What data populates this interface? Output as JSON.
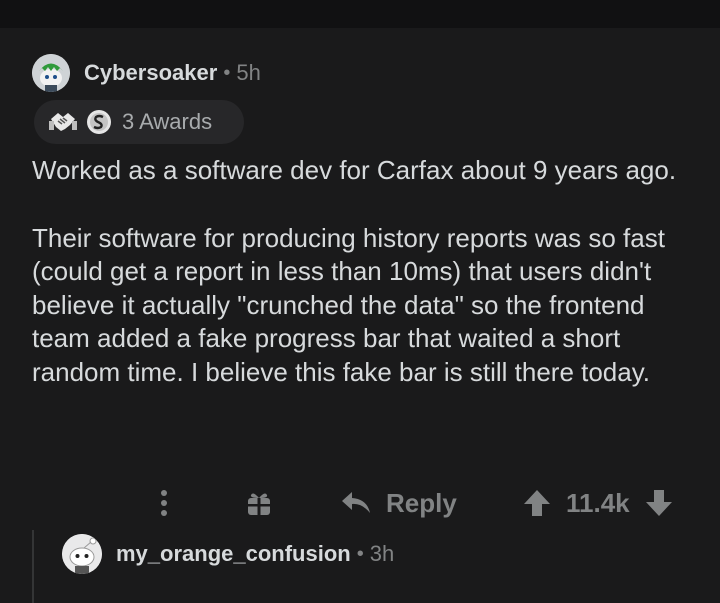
{
  "comment": {
    "username": "Cybersoaker",
    "separator": "•",
    "time": "5h",
    "awards_label": "3 Awards",
    "award_icons": [
      "handshake-icon",
      "silver-coin-icon"
    ],
    "paragraphs": [
      "Worked as a software dev for Carfax about 9 years ago.",
      "Their software for producing history reports was so fast (could get a report in less than 10ms) that users didn't believe it actually \"crunched the data\" so the frontend team added a fake progress bar that waited a short random time. I believe this fake bar is still there today."
    ],
    "actions": {
      "more_icon": "more-vertical-icon",
      "award_icon": "gift-icon",
      "reply_icon": "reply-arrow-icon",
      "reply_label": "Reply",
      "upvote_icon": "upvote-arrow-icon",
      "score": "11.4k",
      "downvote_icon": "downvote-arrow-icon"
    }
  },
  "reply": {
    "username": "my_orange_confusion",
    "separator": "•",
    "time": "3h"
  },
  "colors": {
    "background": "#1a1a1b",
    "text": "#d7dadc",
    "muted": "#818384",
    "pill": "#272729"
  }
}
